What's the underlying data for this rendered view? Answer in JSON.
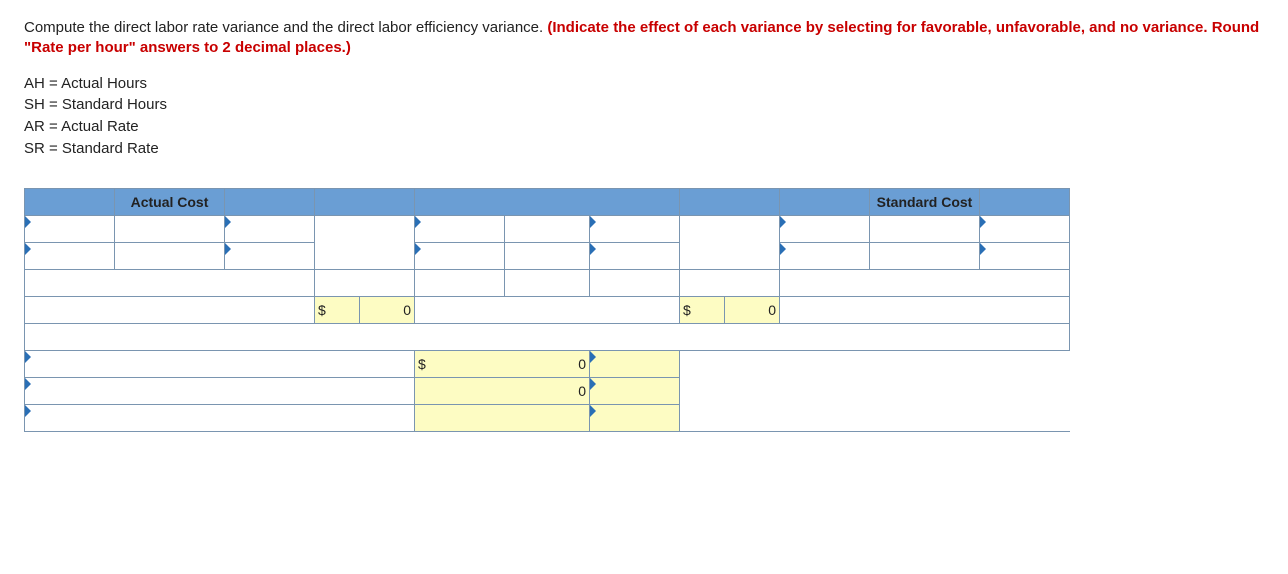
{
  "question": {
    "plain": "Compute the direct labor rate variance and the direct labor efficiency variance. ",
    "bold": "(Indicate the effect of each variance by selecting for favorable, unfavorable, and no variance. Round \"Rate per hour\" answers to 2 decimal places.)"
  },
  "legend": {
    "l1": "AH = Actual Hours",
    "l2": "SH = Standard Hours",
    "l3": "AR = Actual Rate",
    "l4": "SR = Standard Rate"
  },
  "table": {
    "headers": {
      "actual": "Actual Cost",
      "standard": "Standard Cost"
    },
    "dollar": "$",
    "zero": "0"
  }
}
